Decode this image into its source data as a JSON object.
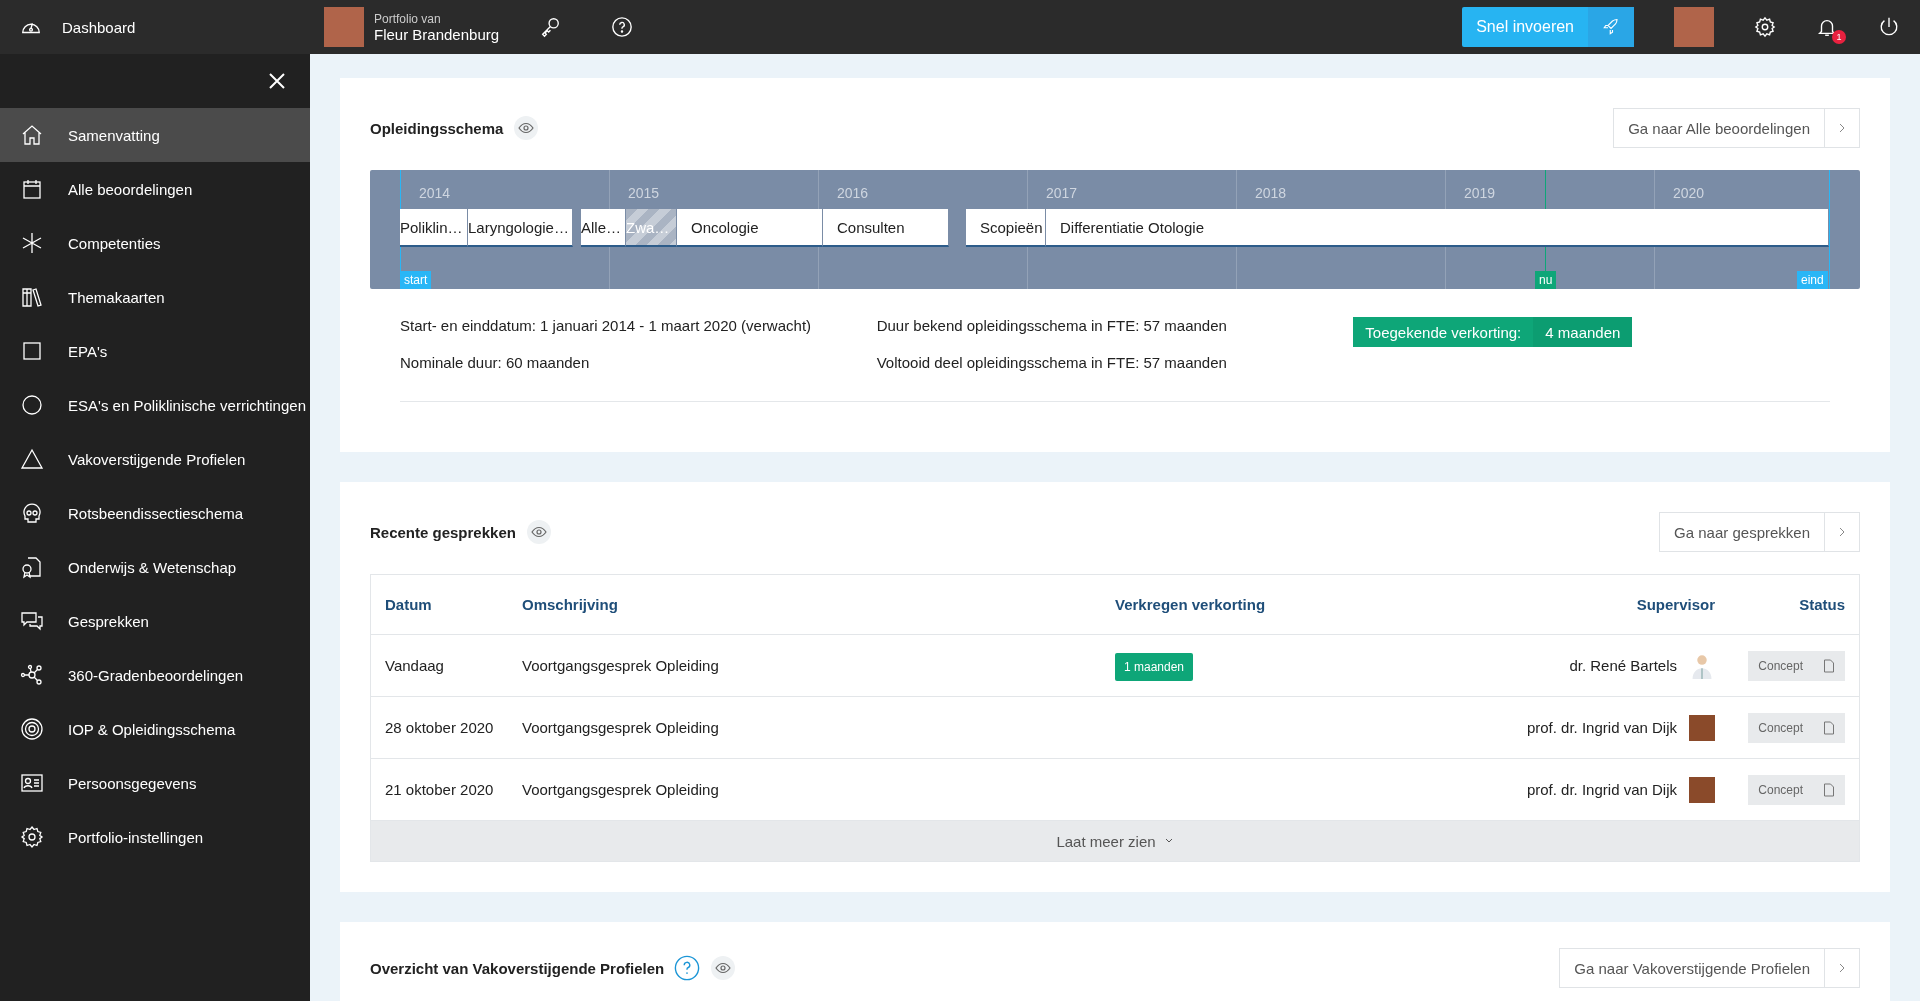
{
  "topbar": {
    "dashboard": "Dashboard",
    "portfolio_label": "Portfolio van",
    "portfolio_name": "Fleur Brandenburg",
    "quick_entry": "Snel invoeren",
    "notification_count": "1"
  },
  "sidebar": {
    "items": [
      {
        "label": "Samenvatting",
        "selected": true
      },
      {
        "label": "Alle beoordelingen",
        "selected": false
      },
      {
        "label": "Competenties",
        "selected": false
      },
      {
        "label": "Themakaarten",
        "selected": false
      },
      {
        "label": "EPA's",
        "selected": false
      },
      {
        "label": "ESA's en Poliklinische verrichtingen",
        "selected": false
      },
      {
        "label": "Vakoverstijgende Profielen",
        "selected": false
      },
      {
        "label": "Rotsbeendissectieschema",
        "selected": false
      },
      {
        "label": "Onderwijs & Wetenschap",
        "selected": false
      },
      {
        "label": "Gesprekken",
        "selected": false
      },
      {
        "label": "360-Gradenbeoordelingen",
        "selected": false
      },
      {
        "label": "IOP & Opleidingsschema",
        "selected": false
      },
      {
        "label": "Persoonsgegevens",
        "selected": false
      },
      {
        "label": "Portfolio-instellingen",
        "selected": false
      }
    ]
  },
  "training_schema": {
    "title": "Opleidingsschema",
    "link": "Ga naar Alle beoordelingen",
    "years": [
      "2014",
      "2015",
      "2016",
      "2017",
      "2018",
      "2019",
      "2020"
    ],
    "blocks": [
      {
        "label": "Poliklin…",
        "kind": "normal"
      },
      {
        "label": "Laryngologie…",
        "kind": "normal"
      },
      {
        "label": "Alle…",
        "kind": "normal"
      },
      {
        "label": "Zwa…",
        "kind": "hatched"
      },
      {
        "label": "Oncologie",
        "kind": "normal"
      },
      {
        "label": "Consulten",
        "kind": "normal"
      },
      {
        "label": "Scopieën",
        "kind": "normal"
      },
      {
        "label": "Differentiatie Otologie",
        "kind": "normal"
      }
    ],
    "markers": [
      {
        "label": "start",
        "kind": "start"
      },
      {
        "label": "nu",
        "kind": "now"
      },
      {
        "label": "eind",
        "kind": "end"
      }
    ],
    "facts": [
      "Start- en einddatum: 1 januari 2014 - 1 maart 2020 (verwacht)",
      "Duur bekend opleidingsschema in FTE: 57 maanden",
      "Nominale duur: 60 maanden",
      "Voltooid deel opleidingsschema in FTE: 57 maanden"
    ],
    "reduction": {
      "label": "Toegekende verkorting:",
      "value": "4 maanden"
    }
  },
  "recent_conversations": {
    "title": "Recente gesprekken",
    "link": "Ga naar gesprekken",
    "columns": [
      "Datum",
      "Omschrijving",
      "Verkregen verkorting",
      "Supervisor",
      "Status"
    ],
    "rows": [
      {
        "date": "Vandaag",
        "description": "Voortgangsgesprek Opleiding",
        "reduction": "1 maanden",
        "supervisor": "dr. René Bartels",
        "kind": "doctor",
        "status": "Concept"
      },
      {
        "date": "28 oktober 2020",
        "description": "Voortgangsgesprek Opleiding",
        "supervisor": "prof. dr. Ingrid van Dijk",
        "kind": "photo",
        "status": "Concept"
      },
      {
        "date": "21 oktober 2020",
        "description": "Voortgangsgesprek Opleiding",
        "supervisor": "prof. dr. Ingrid van Dijk",
        "kind": "photo",
        "status": "Concept"
      }
    ],
    "more": "Laat meer zien"
  },
  "profiles_overview": {
    "title": "Overzicht van Vakoverstijgende Profielen",
    "link": "Ga naar Vakoverstijgende Profielen"
  }
}
